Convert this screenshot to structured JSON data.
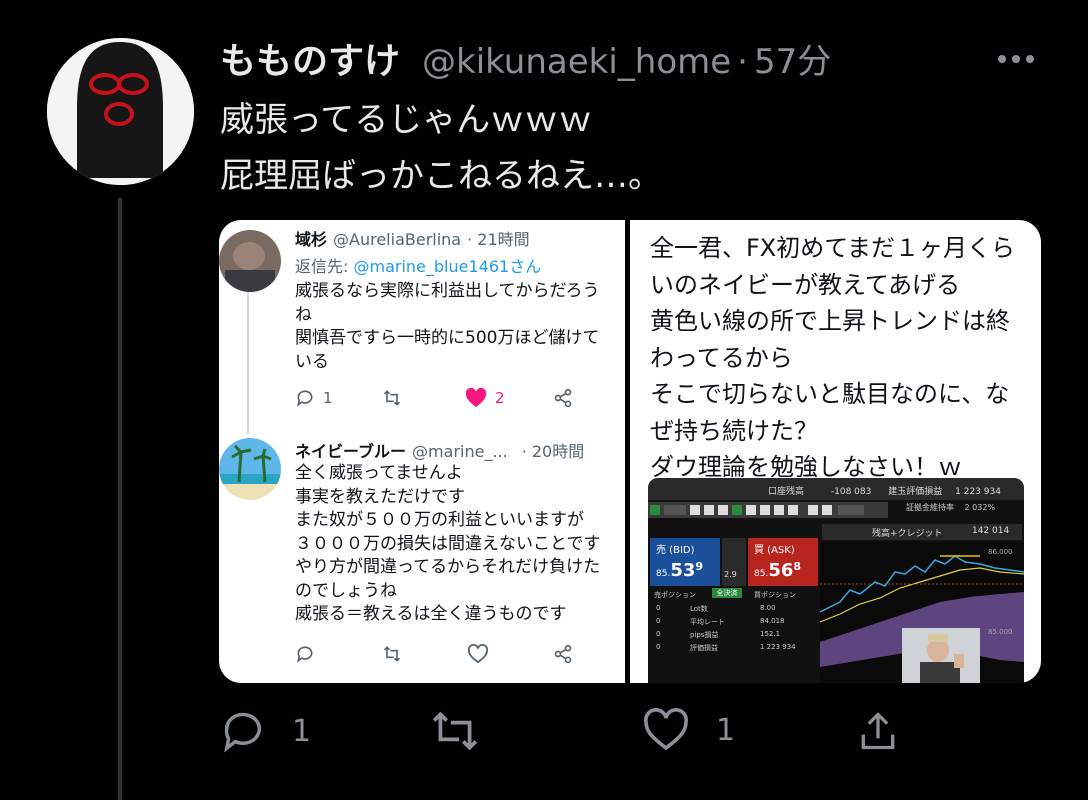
{
  "tweet": {
    "name": "もものすけ",
    "handle": "@kikunaeki_home",
    "separator": "·",
    "time": "57分",
    "text": "威張ってるじゃんｗｗｗ\n屁理屈ばっかこねるねえ…。",
    "reply_count": "1",
    "like_count": "1"
  },
  "embedded_left": {
    "reply1": {
      "name": "域杉",
      "handle": "@AureliaBerlina",
      "time": "· 21時間",
      "reply_to_prefix": "返信先: ",
      "reply_to_handle": "@marine_blue1461さん",
      "text": "威張るなら実際に利益出してからだろう\nね\n関慎吾ですら一時的に500万ほど儲けて\nいる",
      "reply_count": "1",
      "like_count": "2"
    },
    "reply2": {
      "name": "ネイビーブルー",
      "handle": "@marine_...",
      "time": "· 20時間",
      "text": "全く威張ってませんよ\n事実を教えただけです\nまた奴が５００万の利益といいますが\n３０００万の損失は間違えないことです\nやり方が間違ってるからそれだけ負けた\nのでしょうね\n威張る＝教えるは全く違うものです"
    }
  },
  "embedded_right": {
    "text": "全一君、FX初めてまだ１ヶ月くら\nいのネイビーが教えてあげる\n黄色い線の所で上昇トレンドは終\nわってるから\nそこで切らないと駄目なのに、な\nぜ持ち続けた？\nダウ理論を勉強しなさい！ｗ",
    "fx": {
      "title": "口座残高",
      "balance": "-108 083",
      "pl_label": "建玉評価損益",
      "pl_value": "1 223 934",
      "margin_label": "証拠金維持率",
      "margin_value": "2 032%",
      "credit_label": "残高+クレジット",
      "credit_value": "142 014",
      "bid_label": "売 (BID)",
      "ask_label": "買 (ASK)",
      "bid_int": "85.",
      "bid_big": "53",
      "bid_small": "9",
      "ask_int": "85.",
      "ask_big": "56",
      "ask_small": "8",
      "spread": "2.9",
      "sell_pos": "売ポジション",
      "buy_pos": "買ポジション",
      "all_close": "全決済",
      "rows": [
        {
          "label": "Lot数",
          "left": "0",
          "right": "8.00"
        },
        {
          "label": "平均レート",
          "left": "0",
          "right": "84.018"
        },
        {
          "label": "pips損益",
          "left": "0",
          "right": "152.1"
        },
        {
          "label": "評価損益",
          "left": "0",
          "right": "1 223 934"
        }
      ],
      "price_top": "86.000",
      "price_mid": "85.000"
    }
  },
  "colors": {
    "bg": "#000000",
    "text": "#e7e9ea",
    "muted": "#8b9096",
    "like": "#f91880",
    "link": "#1d9bf0"
  }
}
